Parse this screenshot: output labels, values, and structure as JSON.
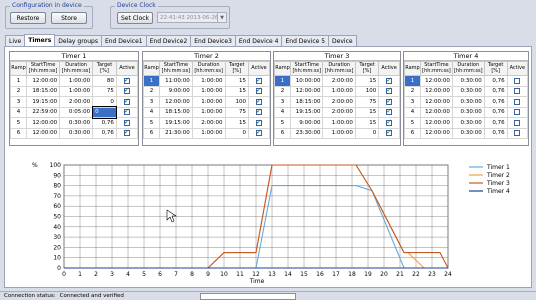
{
  "config": {
    "title": "Configuration in device",
    "restore_label": "Restore",
    "store_label": "Store"
  },
  "clock": {
    "title": "Device Clock",
    "set_label": "Set Clock",
    "value": "22:41:43   2013-06-26"
  },
  "tabs": [
    "Live",
    "Timers",
    "Delay groups",
    "End Device1",
    "End Device2",
    "End Device3",
    "End Device 4",
    "End Device 5",
    "Device"
  ],
  "active_tab": "Timers",
  "timer_table": {
    "headers": {
      "ramp": "Ramp",
      "start": "StartTime [hh:mm:ss]",
      "duration": "Duration [hh:mm:ss]",
      "target": "Target [%]",
      "active": "Active"
    }
  },
  "timers": [
    {
      "title": "Timer 1",
      "rows": [
        {
          "ramp": "1",
          "start": "12:00:00",
          "duration": "1:00:00",
          "target": "80",
          "active": true
        },
        {
          "ramp": "2",
          "start": "18:15:00",
          "duration": "1:00:00",
          "target": "75",
          "active": true
        },
        {
          "ramp": "3",
          "start": "19:15:00",
          "duration": "2:00:00",
          "target": "0",
          "active": true
        },
        {
          "ramp": "4",
          "start": "22:59:00",
          "duration": "0:05:00",
          "target": "0",
          "active": true
        },
        {
          "ramp": "5",
          "start": "12:00:00",
          "duration": "0:30:00",
          "target": "0,76",
          "active": true
        },
        {
          "ramp": "6",
          "start": "12:00:00",
          "duration": "0:30:00",
          "target": "0,76",
          "active": true
        }
      ]
    },
    {
      "title": "Timer 2",
      "rows": [
        {
          "ramp": "1",
          "start": "11:00:00",
          "duration": "1:00:00",
          "target": "15",
          "active": true
        },
        {
          "ramp": "2",
          "start": "9:00:00",
          "duration": "1:00:00",
          "target": "15",
          "active": true
        },
        {
          "ramp": "3",
          "start": "12:00:00",
          "duration": "1:00:00",
          "target": "100",
          "active": true
        },
        {
          "ramp": "4",
          "start": "18:15:00",
          "duration": "1:00:00",
          "target": "75",
          "active": true
        },
        {
          "ramp": "5",
          "start": "19:15:00",
          "duration": "2:00:00",
          "target": "15",
          "active": true
        },
        {
          "ramp": "6",
          "start": "21:30:00",
          "duration": "1:00:00",
          "target": "0",
          "active": true
        }
      ]
    },
    {
      "title": "Timer 3",
      "rows": [
        {
          "ramp": "1",
          "start": "10:00:00",
          "duration": "2:00:00",
          "target": "15",
          "active": true
        },
        {
          "ramp": "2",
          "start": "12:00:00",
          "duration": "1:00:00",
          "target": "100",
          "active": true
        },
        {
          "ramp": "3",
          "start": "18:15:00",
          "duration": "2:00:00",
          "target": "75",
          "active": true
        },
        {
          "ramp": "4",
          "start": "19:15:00",
          "duration": "2:00:00",
          "target": "15",
          "active": true
        },
        {
          "ramp": "5",
          "start": "9:00:00",
          "duration": "1:00:00",
          "target": "15",
          "active": true
        },
        {
          "ramp": "6",
          "start": "23:30:00",
          "duration": "1:00:00",
          "target": "0",
          "active": true
        }
      ]
    },
    {
      "title": "Timer 4",
      "rows": [
        {
          "ramp": "1",
          "start": "12:00:00",
          "duration": "0:30:00",
          "target": "0,76",
          "active": false
        },
        {
          "ramp": "2",
          "start": "12:00:00",
          "duration": "0:30:00",
          "target": "0,76",
          "active": false
        },
        {
          "ramp": "3",
          "start": "12:00:00",
          "duration": "0:30:00",
          "target": "0,76",
          "active": false
        },
        {
          "ramp": "4",
          "start": "12:00:00",
          "duration": "0:30:00",
          "target": "0,76",
          "active": false
        },
        {
          "ramp": "5",
          "start": "12:00:00",
          "duration": "0:30:00",
          "target": "0,76",
          "active": false
        },
        {
          "ramp": "6",
          "start": "12:00:00",
          "duration": "0:30:00",
          "target": "0,76",
          "active": false
        }
      ]
    }
  ],
  "chart_data": {
    "type": "line",
    "xlabel": "Time",
    "ylabel": "%",
    "xlim": [
      0,
      24
    ],
    "ylim": [
      0,
      100
    ],
    "xticks": [
      0,
      1,
      2,
      3,
      4,
      5,
      6,
      7,
      8,
      9,
      10,
      11,
      12,
      13,
      14,
      15,
      16,
      17,
      18,
      19,
      20,
      21,
      22,
      23,
      24
    ],
    "yticks": [
      0,
      10,
      20,
      30,
      40,
      50,
      60,
      70,
      80,
      90,
      100
    ],
    "grid": true,
    "legend": "top-right",
    "series": [
      {
        "name": "Timer 1",
        "color": "#6aa8d8",
        "x": [
          0,
          12,
          13,
          18.25,
          19.25,
          21.25,
          24
        ],
        "y": [
          0,
          0,
          80,
          80,
          75,
          0,
          0
        ]
      },
      {
        "name": "Timer 2",
        "color": "#f0a04b",
        "x": [
          0,
          9,
          10,
          12,
          13,
          18.25,
          19.25,
          21.25,
          21.5,
          22.5,
          24
        ],
        "y": [
          0,
          0,
          15,
          15,
          100,
          100,
          75,
          15,
          15,
          0,
          0
        ]
      },
      {
        "name": "Timer 3",
        "color": "#c85a28",
        "x": [
          0,
          9,
          10,
          11,
          12,
          13,
          18.25,
          19.25,
          21.25,
          23.5,
          24
        ],
        "y": [
          0,
          0,
          15,
          15,
          15,
          100,
          100,
          75,
          15,
          15,
          0
        ]
      },
      {
        "name": "Timer 4",
        "color": "#1f3f9a",
        "x": [
          0,
          24
        ],
        "y": [
          0,
          0
        ]
      }
    ]
  },
  "status": {
    "label": "Connection status:",
    "value": "Connected and verified"
  }
}
